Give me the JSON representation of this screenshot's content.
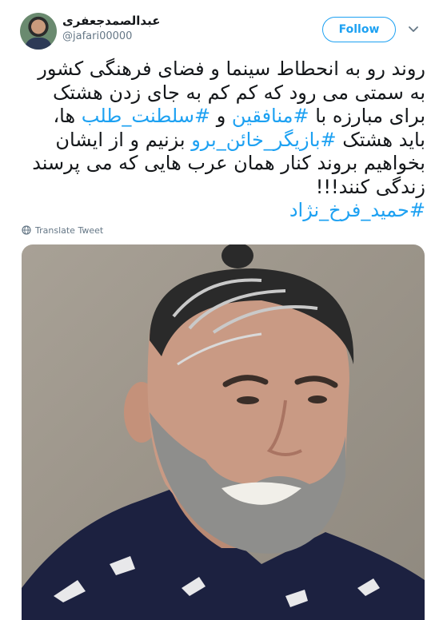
{
  "author": {
    "display_name": "عبدالصمدجعفری",
    "handle": "@jafari00000"
  },
  "follow_label": "Follow",
  "tweet": {
    "t1": "روند رو به انحطاط سینما و فضای فرهنگی کشور به سمتی می رود که کم کم به جای زدن هشتک برای مبارزه با ",
    "h1": "#منافقین",
    "t2": " و ",
    "h2": "#سلطنت_طلب",
    "t3": " ها، باید هشتک ",
    "h3": "#بازیگر_خائن_برو",
    "t4": " بزنیم و از ایشان بخواهیم بروند کنار همان عرب هایی که می پرسند زندگی کنند!!!",
    "h4": "#حمید_فرخ_نژاد"
  },
  "translate_label": "Translate Tweet",
  "icons": {
    "chevron": "chevron-down-icon",
    "globe": "globe-icon"
  },
  "colors": {
    "accent": "#1da1f2",
    "secondary_text": "#657786",
    "primary_text": "#14171a"
  }
}
